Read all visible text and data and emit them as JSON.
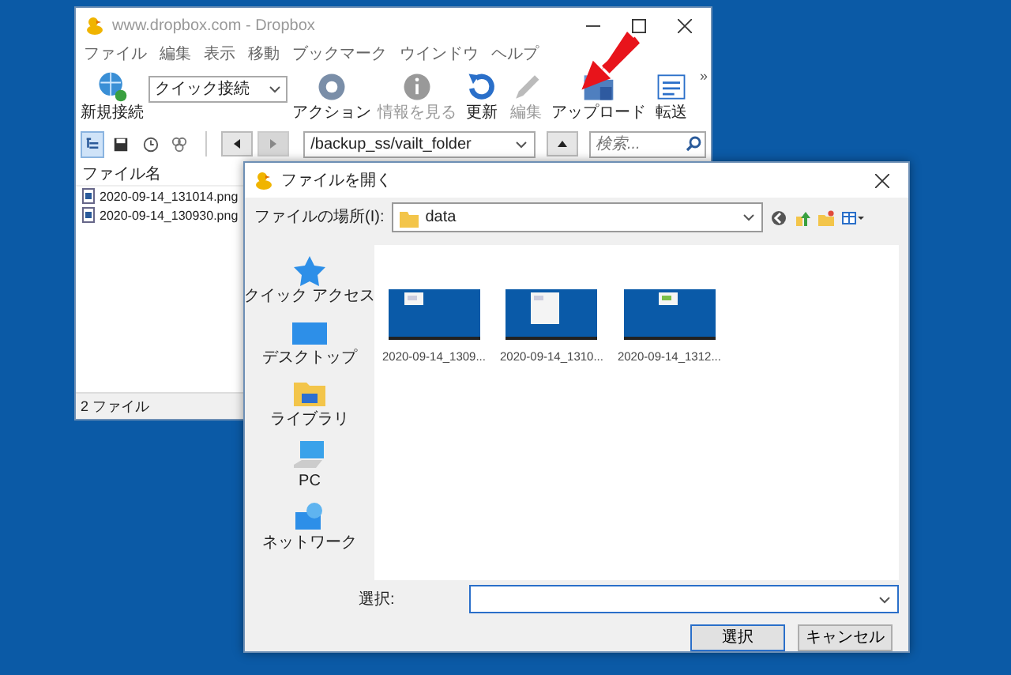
{
  "main_window": {
    "title": "www.dropbox.com - Dropbox",
    "menu": [
      "ファイル",
      "編集",
      "表示",
      "移動",
      "ブックマーク",
      "ウインドウ",
      "ヘルプ"
    ],
    "toolbar": [
      {
        "kind": "connect",
        "label": "新規接続",
        "disabled": false
      },
      {
        "kind": "combo",
        "value": "クイック接続",
        "disabled": false
      },
      {
        "kind": "action",
        "label": "アクション",
        "disabled": false
      },
      {
        "kind": "info",
        "label": "情報を見る",
        "disabled": true
      },
      {
        "kind": "refresh",
        "label": "更新",
        "disabled": false
      },
      {
        "kind": "edit",
        "label": "編集",
        "disabled": true
      },
      {
        "kind": "upload",
        "label": "アップロード",
        "disabled": false
      },
      {
        "kind": "transfer",
        "label": "転送",
        "disabled": false
      }
    ],
    "overflow": "»",
    "view_buttons": [
      {
        "kind": "tree",
        "selected": true
      },
      {
        "kind": "save",
        "selected": false
      },
      {
        "kind": "clock",
        "selected": false
      },
      {
        "kind": "link",
        "selected": false
      }
    ],
    "nav_buttons": [
      {
        "kind": "back",
        "disabled": false
      },
      {
        "kind": "forward",
        "disabled": true
      }
    ],
    "path": "/backup_ss/vailt_folder",
    "search": {
      "placeholder": "検索..."
    },
    "list_header": "ファイル名",
    "files": [
      "2020-09-14_131014.png",
      "2020-09-14_130930.png"
    ],
    "status_bar": "2 ファイル"
  },
  "dialog": {
    "title": "ファイルを開く",
    "location_label": "ファイルの場所(I):",
    "location": "data",
    "places": [
      {
        "kind": "quick",
        "label": "クイック アクセス"
      },
      {
        "kind": "desktop",
        "label": "デスクトップ"
      },
      {
        "kind": "library",
        "label": "ライブラリ"
      },
      {
        "kind": "pc",
        "label": "PC"
      },
      {
        "kind": "network",
        "label": "ネットワーク"
      }
    ],
    "files": [
      {
        "name": "2020-09-14_1309...",
        "kind": "picture"
      },
      {
        "name": "2020-09-14_1310...",
        "kind": "picture"
      },
      {
        "name": "2020-09-14_1312...",
        "kind": "picture"
      }
    ],
    "select_label": "選択:",
    "buttons": [
      {
        "label": "選択",
        "default": true
      },
      {
        "label": "キャンセル",
        "default": false
      }
    ]
  }
}
